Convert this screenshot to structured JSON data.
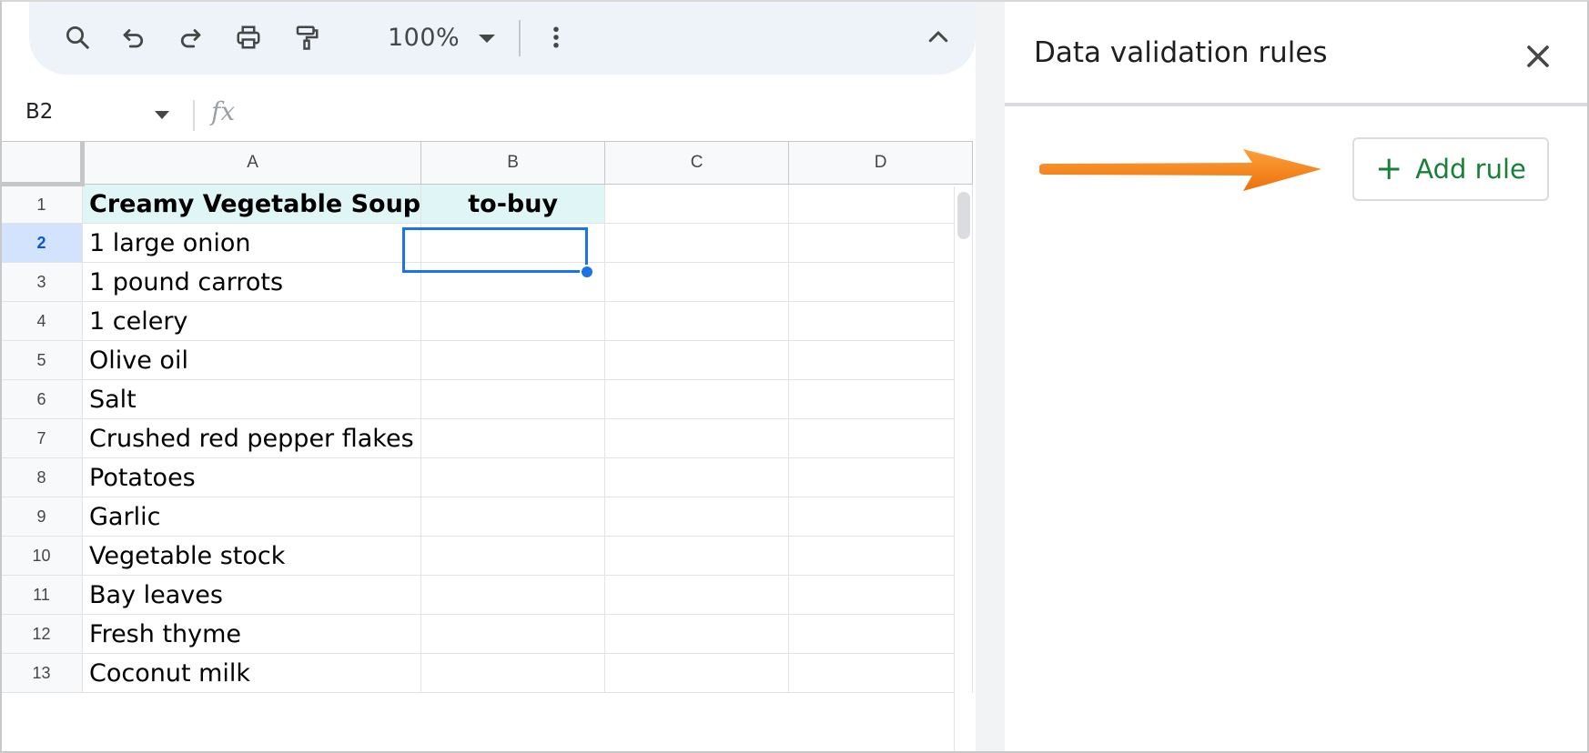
{
  "toolbar": {
    "zoom": "100%",
    "icons": [
      "search-icon",
      "undo-icon",
      "redo-icon",
      "print-icon",
      "paint-format-icon",
      "more-vert-icon",
      "chevron-up-icon"
    ]
  },
  "formula_bar": {
    "name_box": "B2",
    "fx": "fx"
  },
  "grid": {
    "columns": [
      "A",
      "B",
      "C",
      "D"
    ],
    "selected_cell": "B2",
    "rows": [
      {
        "num": "1",
        "a": "Creamy Vegetable Soup",
        "b": "to-buy"
      },
      {
        "num": "2",
        "a": "1 large onion",
        "b": ""
      },
      {
        "num": "3",
        "a": "1 pound carrots",
        "b": ""
      },
      {
        "num": "4",
        "a": "1 celery",
        "b": ""
      },
      {
        "num": "5",
        "a": "Olive oil",
        "b": ""
      },
      {
        "num": "6",
        "a": "Salt",
        "b": ""
      },
      {
        "num": "7",
        "a": "Crushed red pepper flakes",
        "b": ""
      },
      {
        "num": "8",
        "a": "Potatoes",
        "b": ""
      },
      {
        "num": "9",
        "a": "Garlic",
        "b": ""
      },
      {
        "num": "10",
        "a": "Vegetable stock",
        "b": ""
      },
      {
        "num": "11",
        "a": "Bay leaves",
        "b": ""
      },
      {
        "num": "12",
        "a": "Fresh thyme",
        "b": ""
      },
      {
        "num": "13",
        "a": "Coconut milk",
        "b": ""
      }
    ]
  },
  "panel": {
    "title": "Data validation rules",
    "add_rule_label": "Add rule"
  },
  "colors": {
    "accent_blue": "#1a73e8",
    "header_fill": "#e0f6f6",
    "add_rule_green": "#188038",
    "annotation_arrow": "#f57c00"
  }
}
